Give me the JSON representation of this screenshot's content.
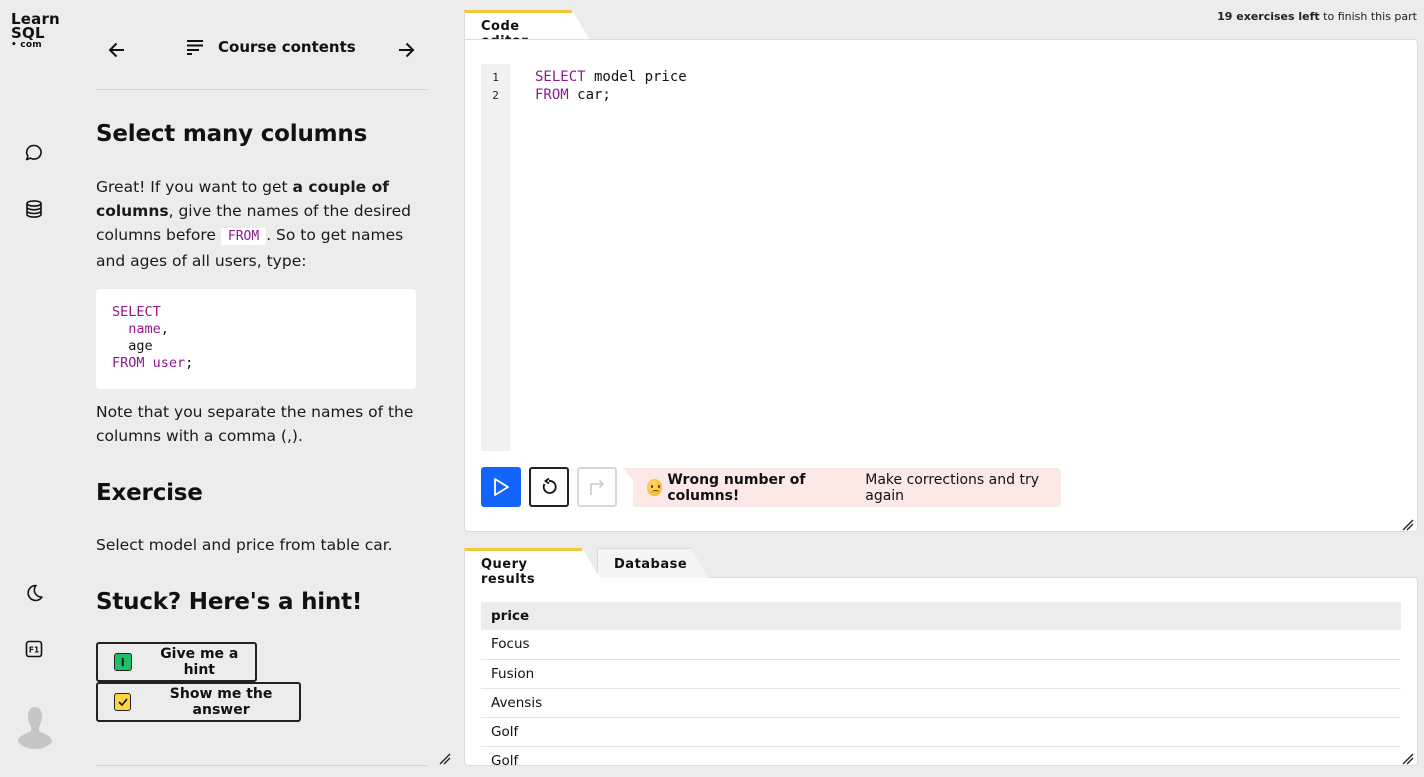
{
  "brand": {
    "line1": "Learn",
    "line2": "SQL",
    "line3": "• com"
  },
  "rail": {
    "icons": [
      "chat-icon",
      "database-icon",
      "dark-mode-icon",
      "f1-help-icon",
      "avatar"
    ],
    "f1_label": "F1"
  },
  "nav": {
    "prev_icon": "arrow-left-icon",
    "menu_icon": "list-icon",
    "title": "Course contents",
    "next_icon": "arrow-right-icon"
  },
  "lesson": {
    "title": "Select many columns",
    "intro": {
      "t1": "Great! If you want to get ",
      "bold": "a couple of columns",
      "t2": ", give the names of the desired columns before ",
      "code": "FROM",
      "t3": ". So to get names and ages of all users, type:"
    },
    "example_code": [
      {
        "text": "SELECT",
        "kw": true
      },
      {
        "text": "  name,",
        "kw": true
      },
      {
        "text": "  age",
        "kw": false
      },
      {
        "text": "FROM user;",
        "kw": true
      }
    ],
    "note": "Note that you separate the names of the columns with a comma (,).",
    "exercise_heading": "Exercise",
    "exercise_text": "Select model and price from table car.",
    "hint_heading": "Stuck? Here's a hint!",
    "hint_button": "Give me a hint",
    "answer_button": "Show me the answer",
    "hint_icon_glyph": "i"
  },
  "progress": {
    "count": "19 exercises left",
    "suffix": " to finish this part"
  },
  "editor": {
    "tab": "Code editor",
    "line_numbers": [
      "1",
      "2"
    ],
    "lines": [
      {
        "kw": "SELECT",
        "rest": " model price"
      },
      {
        "kw": "FROM",
        "rest": " car;"
      }
    ],
    "message_bold": "Wrong number of columns!",
    "message_rest": "Make corrections and try again",
    "colors": {
      "run": "#1264fb",
      "error_bg": "#fde8e8",
      "tab_accent": "#f0c93a"
    }
  },
  "results": {
    "tabs": [
      "Query results",
      "Database"
    ],
    "columns": [
      "price"
    ],
    "rows": [
      "Focus",
      "Fusion",
      "Avensis",
      "Golf",
      "Golf"
    ]
  }
}
